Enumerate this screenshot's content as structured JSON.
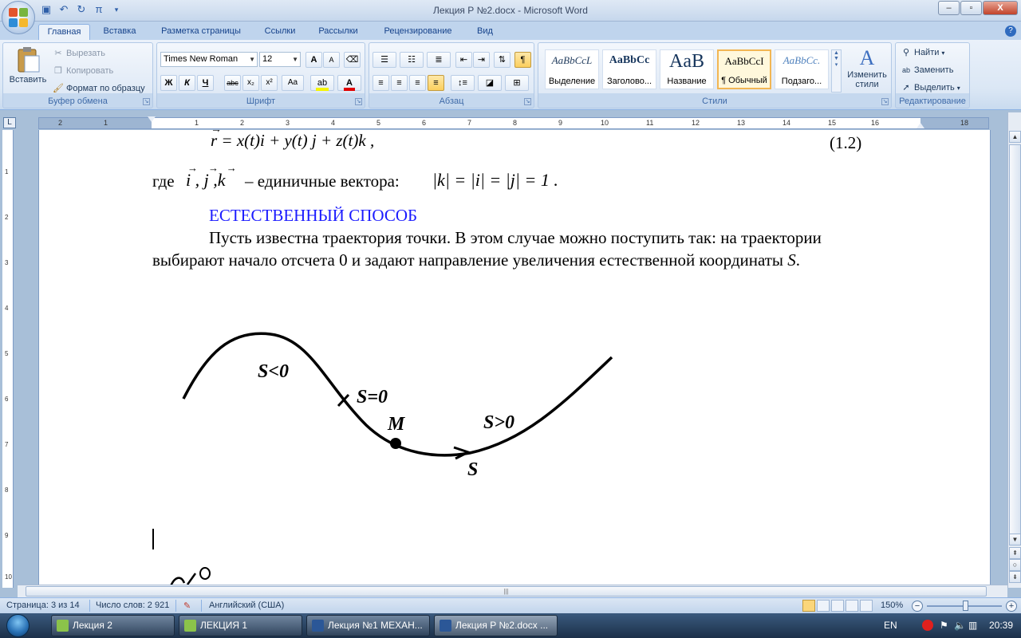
{
  "window": {
    "title": "Лекция Р №2.docx - Microsoft Word",
    "qat_icons": [
      "save-icon",
      "undo-icon",
      "redo-icon",
      "pi-icon",
      "dropdown-icon"
    ],
    "buttons": {
      "minimize": "–",
      "maximize": "▫",
      "close": "X"
    }
  },
  "tabs": [
    "Главная",
    "Вставка",
    "Разметка страницы",
    "Ссылки",
    "Рассылки",
    "Рецензирование",
    "Вид"
  ],
  "active_tab": "Главная",
  "ribbon": {
    "clipboard": {
      "label": "Буфер обмена",
      "paste": "Вставить",
      "cut": "Вырезать",
      "copy": "Копировать",
      "format_painter": "Формат по образцу"
    },
    "font": {
      "label": "Шрифт",
      "font_name": "Times New Roman",
      "font_size": "12",
      "bold": "Ж",
      "italic": "К",
      "underline": "Ч",
      "strike": "abc",
      "subscript": "x₂",
      "superscript": "x²",
      "change_case": "Aa",
      "grow": "A",
      "shrink": "A"
    },
    "paragraph": {
      "label": "Абзац"
    },
    "styles": {
      "label": "Стили",
      "items": [
        {
          "sample": "AaBbCcL",
          "name": "Выделение"
        },
        {
          "sample": "AaBbCc",
          "name": "Заголово..."
        },
        {
          "sample": "AaB",
          "name": "Название"
        },
        {
          "sample": "AaBbCcI",
          "name": "¶ Обычный"
        },
        {
          "sample": "AaBbCc.",
          "name": "Подзаго..."
        }
      ],
      "change_styles": "Изменить стили"
    },
    "editing": {
      "label": "Редактирование",
      "find": "Найти",
      "replace": "Заменить",
      "select": "Выделить"
    }
  },
  "ruler": {
    "corner": "L",
    "ticks": [
      "2",
      "1",
      "1",
      "2",
      "3",
      "4",
      "5",
      "6",
      "7",
      "8",
      "9",
      "10",
      "11",
      "12",
      "13",
      "14",
      "15",
      "16",
      "18"
    ],
    "vticks": [
      "1",
      "1",
      "2",
      "3",
      "4",
      "5",
      "6",
      "7",
      "8",
      "9",
      "10"
    ]
  },
  "document": {
    "formula_main": "r = x(t)i + y(t) j + z(t)k ,",
    "formula_number": "(1.2)",
    "unit_line_prefix": "где",
    "unit_vectors": "i , j ,k",
    "unit_line_text": "– единичные вектора:",
    "unit_formula": "|k| = |i| = |j| = 1 .",
    "heading": "ЕСТЕСТВЕННЫЙ СПОСОБ",
    "para_line1": "Пусть известна траектория точки. В этом случае можно поступить так: на траектории",
    "para_line2": "выбирают начало отсчета 0 и задают направление увеличения естественной координаты",
    "para_var": "S",
    "para_end": ".",
    "figure": {
      "label_neg": "S<0",
      "label_zero": "S=0",
      "label_point": "M",
      "label_pos": "S>0",
      "label_axis": "S"
    }
  },
  "statusbar": {
    "page": "Страница: 3 из 14",
    "words": "Число слов: 2 921",
    "language": "Английский (США)",
    "zoom": "150%"
  },
  "taskbar": {
    "items": [
      {
        "label": "Лекция 2"
      },
      {
        "label": "ЛЕКЦИЯ 1"
      },
      {
        "label": "Лекция №1 МЕХАН..."
      },
      {
        "label": "Лекция Р №2.docx ..."
      }
    ],
    "lang": "EN",
    "time": "20:39"
  }
}
